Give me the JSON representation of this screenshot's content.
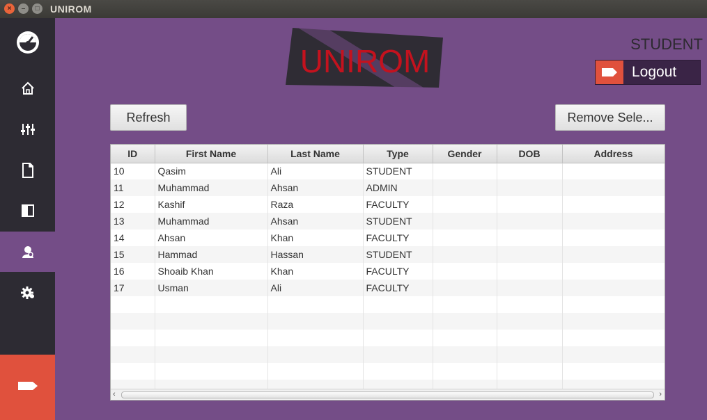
{
  "window": {
    "title": "UNIROM",
    "controls": [
      "×",
      "–",
      "□"
    ]
  },
  "header": {
    "logo_text": "UNIROM",
    "role": "STUDENT",
    "logout_label": "Logout"
  },
  "toolbar": {
    "refresh_label": "Refresh",
    "remove_label": "Remove Sele..."
  },
  "sidebar": {
    "items": [
      {
        "icon": "dashboard-icon",
        "active": false
      },
      {
        "icon": "home-icon",
        "active": false
      },
      {
        "icon": "sliders-icon",
        "active": false
      },
      {
        "icon": "document-icon",
        "active": false
      },
      {
        "icon": "book-icon",
        "active": false
      },
      {
        "icon": "users-icon",
        "active": true
      },
      {
        "icon": "gear-icon",
        "active": false
      },
      {
        "icon": "logout-icon",
        "active": false
      }
    ]
  },
  "table": {
    "columns": [
      "ID",
      "First Name",
      "Last Name",
      "Type",
      "Gender",
      "DOB",
      "Address"
    ],
    "rows": [
      [
        "10",
        "Qasim",
        "Ali",
        "STUDENT",
        "",
        "",
        ""
      ],
      [
        "11",
        "Muhammad",
        "Ahsan",
        "ADMIN",
        "",
        "",
        ""
      ],
      [
        "12",
        "Kashif",
        "Raza",
        "FACULTY",
        "",
        "",
        ""
      ],
      [
        "13",
        "Muhammad",
        "Ahsan",
        "STUDENT",
        "",
        "",
        ""
      ],
      [
        "14",
        "Ahsan",
        "Khan",
        "FACULTY",
        "",
        "",
        ""
      ],
      [
        "15",
        "Hammad",
        "Hassan",
        "STUDENT",
        "",
        "",
        ""
      ],
      [
        "16",
        "Shoaib Khan",
        "Khan",
        "FACULTY",
        "",
        "",
        ""
      ],
      [
        "17",
        "Usman",
        "Ali",
        "FACULTY",
        "",
        "",
        ""
      ]
    ]
  },
  "colors": {
    "background": "#744d87",
    "sidebar": "#2d2b33",
    "accent": "#e0513d",
    "logo_red": "#c4121e"
  }
}
